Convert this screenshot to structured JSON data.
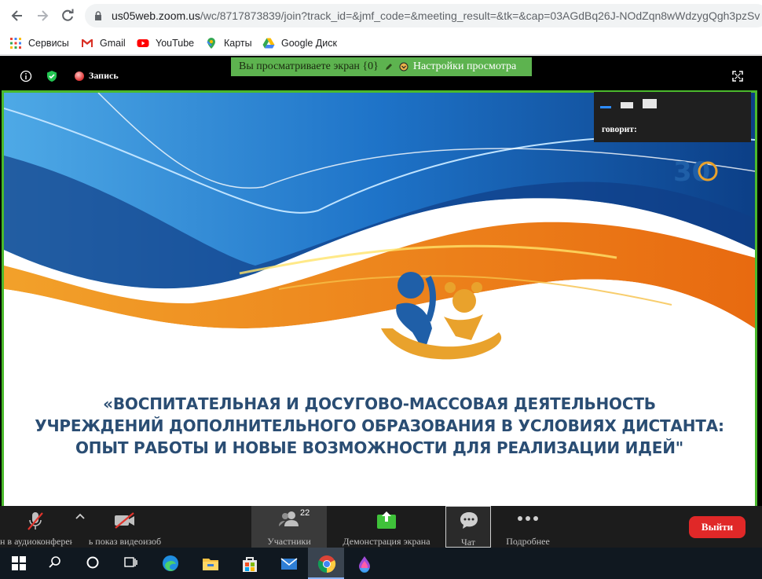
{
  "browser": {
    "url_host": "us05web.zoom.us",
    "url_path": "/wc/8717873839/join?track_id=&jmf_code=&meeting_result=&tk=&cap=03AGdBq26J-NOdZqn8wWdzygQgh3pzSv",
    "bookmarks": [
      {
        "label": "Сервисы",
        "icon": "apps-grid-icon"
      },
      {
        "label": "Gmail",
        "icon": "gmail-icon"
      },
      {
        "label": "YouTube",
        "icon": "youtube-icon"
      },
      {
        "label": "Карты",
        "icon": "maps-icon"
      },
      {
        "label": "Google Диск",
        "icon": "drive-icon"
      }
    ]
  },
  "zoom": {
    "recording_label": "Запись",
    "banner_text": "Вы просматриваете экран {0}",
    "view_options_label": "Настройки просмотра",
    "speaker_label": "говорит:",
    "slide": {
      "title_lines": [
        "«ВОСПИТАТЕЛЬНАЯ И ДОСУГОВО-МАССОВАЯ ДЕЯТЕЛЬНОСТЬ",
        "УЧРЕЖДЕНИЙ ДОПОЛНИТЕЛЬНОГО ОБРАЗОВАНИЯ В УСЛОВИЯХ  ДИСТАНТА:",
        "ОПЫТ РАБОТЫ И НОВЫЕ ВОЗМОЖНОСТИ ДЛЯ РЕАЛИЗАЦИИ ИДЕЙ\""
      ],
      "badge_number": "30"
    },
    "toolbar": {
      "audio_label": "н в аудиоконференц",
      "video_label": "ь показ видеоизоб",
      "participants_label": "Участники",
      "participants_count": "22",
      "share_label": "Демонстрация экрана",
      "chat_label": "Чат",
      "more_label": "Подробнее",
      "leave_label": "Выйти"
    }
  },
  "colors": {
    "share_border": "#4ab92c",
    "banner_bg": "#5db34f",
    "leave_bg": "#e02828",
    "slide_blue": "#1f5fa8",
    "slide_orange": "#f0921c"
  }
}
